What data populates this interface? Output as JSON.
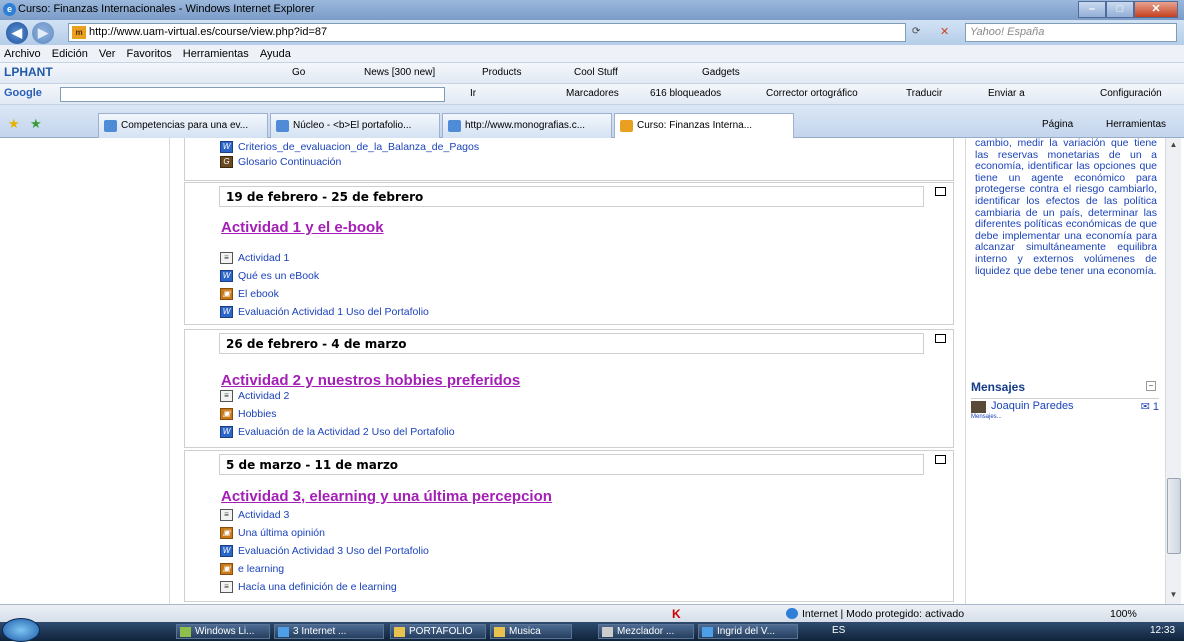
{
  "window": {
    "title": "Curso: Finanzas Internacionales - Windows Internet Explorer"
  },
  "address": {
    "url": "http://www.uam-virtual.es/course/view.php?id=87",
    "search_placeholder": "Yahoo! España"
  },
  "menu": [
    "Archivo",
    "Edición",
    "Ver",
    "Favoritos",
    "Herramientas",
    "Ayuda"
  ],
  "toolbar1": {
    "brand": "LPHANT",
    "go": "Go",
    "news": "News [300 new]",
    "products": "Products",
    "cool": "Cool Stuff",
    "gadgets": "Gadgets"
  },
  "toolbar2": {
    "google": "Google",
    "ir": "Ir",
    "marcadores": "Marcadores",
    "bloqueados": "616 bloqueados",
    "corrector": "Corrector ortográfico",
    "traducir": "Traducir",
    "enviar": "Enviar a",
    "config": "Configuración"
  },
  "tabs": [
    {
      "label": "Competencias para una ev...",
      "active": false
    },
    {
      "label": "Núcleo - <b>El portafolio...",
      "active": false
    },
    {
      "label": "http://www.monografias.c...",
      "active": false
    },
    {
      "label": "Curso: Finanzas Interna...",
      "active": true
    }
  ],
  "tab_tools": {
    "pagina": "Página",
    "herramientas": "Herramientas"
  },
  "top_links": [
    {
      "label": "Criterios_de_evaluacion_de_la_Balanza_de_Pagos",
      "icon": "word"
    },
    {
      "label": "Glosario Continuación",
      "icon": "glos"
    }
  ],
  "sections": [
    {
      "heading": "19 de febrero - 25 de febrero",
      "title": "Actividad 1 y el e-book",
      "items": [
        {
          "label": "Actividad 1",
          "icon": "doc"
        },
        {
          "label": "Qué es un eBook",
          "icon": "word"
        },
        {
          "label": "El ebook",
          "icon": "pic"
        },
        {
          "label": "Evaluación Actividad 1 Uso del Portafolio",
          "icon": "word"
        }
      ]
    },
    {
      "heading": "26 de febrero - 4 de marzo",
      "title": "Actividad 2 y nuestros hobbies preferidos",
      "items": [
        {
          "label": "Actividad 2",
          "icon": "doc"
        },
        {
          "label": "Hobbies",
          "icon": "pic"
        },
        {
          "label": "Evaluación de la Actividad 2 Uso del Portafolio",
          "icon": "word"
        }
      ]
    },
    {
      "heading": "5 de marzo - 11 de marzo",
      "title": "Actividad 3, elearning y una última percepcion",
      "items": [
        {
          "label": "Actividad 3",
          "icon": "doc"
        },
        {
          "label": "Una última opinión",
          "icon": "pic"
        },
        {
          "label": "Evaluación Actividad 3 Uso del Portafolio",
          "icon": "word"
        },
        {
          "label": "e learning",
          "icon": "pic"
        },
        {
          "label": "Hacía una definición de e learning",
          "icon": "doc"
        }
      ]
    }
  ],
  "right": {
    "text": "cambio, medir la variación que tiene las reservas monetarias de un a economía, identificar las opciones que tiene un agente económico para protegerse contra el riesgo cambiarlo, identificar los efectos de las política cambiaria de un país, determinar las diferentes políticas económicas de que debe implementar una economía para alcanzar simultáneamente equilibra interno y externos volúmenes de liquidez que debe tener una economía.",
    "messages_title": "Mensajes",
    "message_user": "Joaquin Paredes",
    "message_count": "1",
    "messages_link": "Mensajes..."
  },
  "status": {
    "zone": "Internet | Modo protegido: activado",
    "zoom": "100%"
  },
  "taskbar": {
    "items": [
      "Windows Li...",
      "3 Internet ...",
      "PORTAFOLIO",
      "Musica",
      "Mezclador ...",
      "Ingrid del V..."
    ],
    "lang": "ES",
    "clock": "12:33"
  },
  "colors": {
    "link": "#1b43b9",
    "activity": "#a31fb5",
    "heading": "#143c86"
  }
}
